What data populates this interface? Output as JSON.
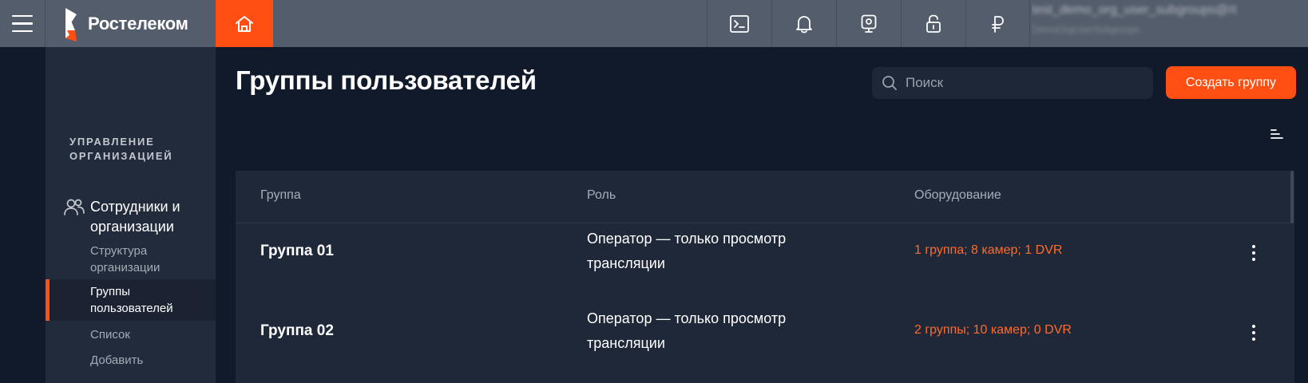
{
  "header": {
    "brand": "Ростелеком",
    "icons": [
      "menu-icon",
      "home-icon",
      "console-icon",
      "bell-icon",
      "camera-icon",
      "lock-icon",
      "ruble-icon"
    ],
    "user_login": "test_demo_org_user_subgroups@rt",
    "user_org": "DemoOrgUserSubgroups"
  },
  "sidebar": {
    "section_title": "УПРАВЛЕНИЕ ОРГАНИЗАЦИЕЙ",
    "main_item": "Сотрудники и организации",
    "sub_items": [
      {
        "label": "Структура организации",
        "active": false
      },
      {
        "label": "Группы пользователей",
        "active": true
      },
      {
        "label": "Список",
        "active": false
      },
      {
        "label": "Добавить",
        "active": false
      }
    ]
  },
  "main": {
    "title": "Группы пользователей",
    "search_placeholder": "Поиск",
    "create_button": "Создать группу",
    "table": {
      "headers": [
        "Группа",
        "Роль",
        "Оборудование"
      ],
      "rows": [
        {
          "group": "Группа 01",
          "role": "Оператор — только просмотр трансляции",
          "equipment": "1 группа; 8 камер; 1 DVR"
        },
        {
          "group": "Группа 02",
          "role": "Оператор — только просмотр трансляции",
          "equipment": "2 группы; 10 камер; 0 DVR"
        }
      ]
    }
  },
  "colors": {
    "accent": "#ff4f12",
    "topbar": "#545d6b",
    "background": "#111a2b",
    "sidebar": "#222b3b",
    "equipment_link": "#ff6a2a"
  }
}
